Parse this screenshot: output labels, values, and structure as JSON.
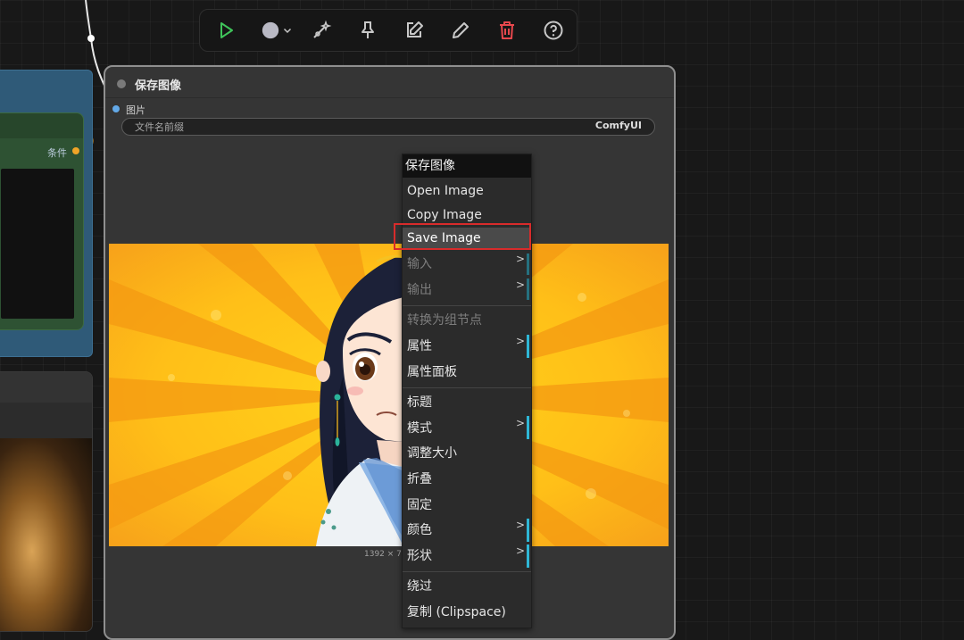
{
  "toolbar": {
    "icons": [
      "play-icon",
      "color-circle-icon",
      "chevron-down-icon",
      "bypass-wand-icon",
      "pin-icon",
      "edit-note-icon",
      "pencil-icon",
      "trash-icon",
      "help-icon"
    ],
    "colors": {
      "play": "#3fc45a",
      "trash": "#e8484d",
      "icon": "#c8c8c8"
    }
  },
  "left_node": {
    "output_label": "条件"
  },
  "main_node": {
    "title": "保存图像",
    "input_label": "图片",
    "widget_label": "文件名前缀",
    "widget_value": "ComfyUI",
    "image_dims": "1392 × 7"
  },
  "context_menu": {
    "title": "保存图像",
    "items": [
      {
        "label": "Open Image"
      },
      {
        "label": "Copy Image"
      },
      {
        "label": "Save Image",
        "highlighted": true
      },
      {
        "label": "输入",
        "disabled": true,
        "submenu": true
      },
      {
        "label": "输出",
        "disabled": true,
        "submenu": true
      },
      {
        "label": "转换为组节点",
        "disabled": true
      },
      {
        "label": "属性",
        "submenu": true
      },
      {
        "label": "属性面板"
      },
      {
        "label": "标题"
      },
      {
        "label": "模式",
        "submenu": true
      },
      {
        "label": "调整大小"
      },
      {
        "label": "折叠"
      },
      {
        "label": "固定"
      },
      {
        "label": "颜色",
        "submenu": true
      },
      {
        "label": "形状",
        "submenu": true
      },
      {
        "label": "绕过"
      },
      {
        "label": "复制 (Clipspace)"
      }
    ],
    "arrow": ">"
  }
}
